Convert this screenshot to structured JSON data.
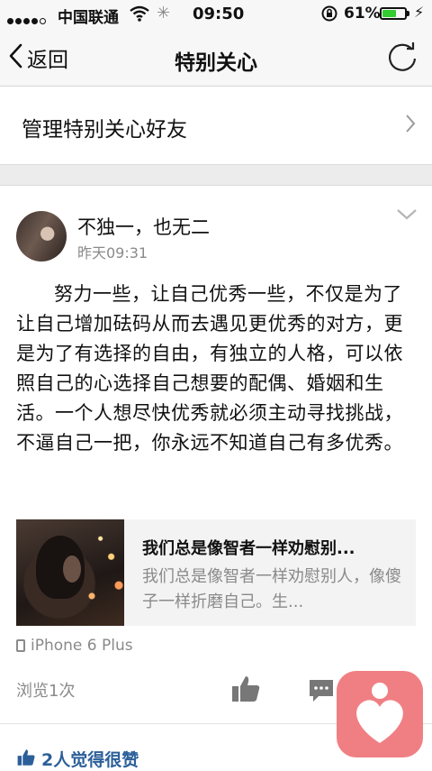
{
  "status_bar": {
    "carrier": "中国联通",
    "time": "09:50",
    "battery_percent": "61%",
    "battery_level": 0.61
  },
  "nav": {
    "back_label": "返回",
    "title": "特别关心"
  },
  "manage_row": {
    "label": "管理特别关心好友"
  },
  "post": {
    "author": "不独一，也无二",
    "time": "昨天09:31",
    "text": "努力一些，让自己优秀一些，不仅是为了让自己增加砝码从而去遇见更优秀的对方，更是为了有选择的自由，有独立的人格，可以依照自己的心选择自己想要的配偶、婚姻和生活。一个人想尽快优秀就必须主动寻找挑战，不逼自己一把，你永远不知道自己有多优秀。",
    "link_card": {
      "title": "我们总是像智者一样劝慰别...",
      "description": "我们总是像智者一样劝慰别人，像傻子一样折磨自己。生..."
    },
    "device": "iPhone 6 Plus",
    "views": "浏览1次",
    "liked_by": "2人觉得很赞"
  },
  "icons": {
    "back": "chevron-left-icon",
    "refresh": "refresh-icon",
    "chevron": "chevron-right-icon",
    "like": "thumbs-up-icon",
    "comment": "comment-icon",
    "app_badge": "heart-person-icon"
  },
  "colors": {
    "link_blue": "#2c5f99",
    "badge_pink": "#f07f84",
    "battery_green": "#33cc33"
  }
}
